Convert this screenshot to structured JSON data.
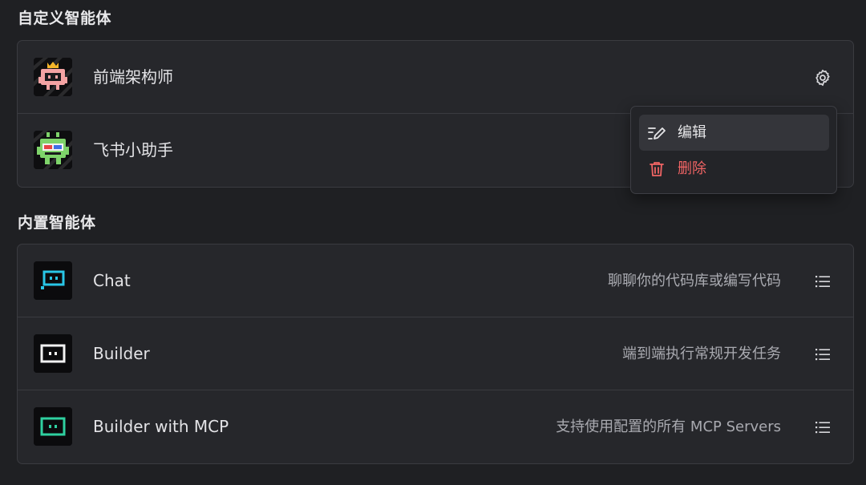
{
  "sections": {
    "custom_title": "自定义智能体",
    "builtin_title": "内置智能体"
  },
  "custom_agents": [
    {
      "name": "前端架构师",
      "avatar": "pink-robot-crown-avatar",
      "action_icon": "gear-icon"
    },
    {
      "name": "飞书小助手",
      "avatar": "green-robot-3d-glasses-avatar"
    }
  ],
  "builtin_agents": [
    {
      "name": "Chat",
      "description": "聊聊你的代码库或编写代码",
      "avatar": "cyan-chat-bot-avatar",
      "action_icon": "list-icon"
    },
    {
      "name": "Builder",
      "description": "端到端执行常规开发任务",
      "avatar": "white-builder-bot-avatar",
      "action_icon": "list-icon"
    },
    {
      "name": "Builder with MCP",
      "description": "支持使用配置的所有 MCP Servers",
      "avatar": "green-builder-bot-avatar",
      "action_icon": "list-icon"
    }
  ],
  "context_menu": {
    "items": [
      {
        "label": "编辑",
        "icon": "edit-icon",
        "color": "#e6e6e8"
      },
      {
        "label": "删除",
        "icon": "trash-icon",
        "color": "#f06464"
      }
    ]
  },
  "colors": {
    "background": "#1f2023",
    "card": "#26272b",
    "border": "#3a3b40",
    "danger": "#f06464",
    "chat_accent": "#29c6e6",
    "mcp_accent": "#2fd0a0"
  }
}
